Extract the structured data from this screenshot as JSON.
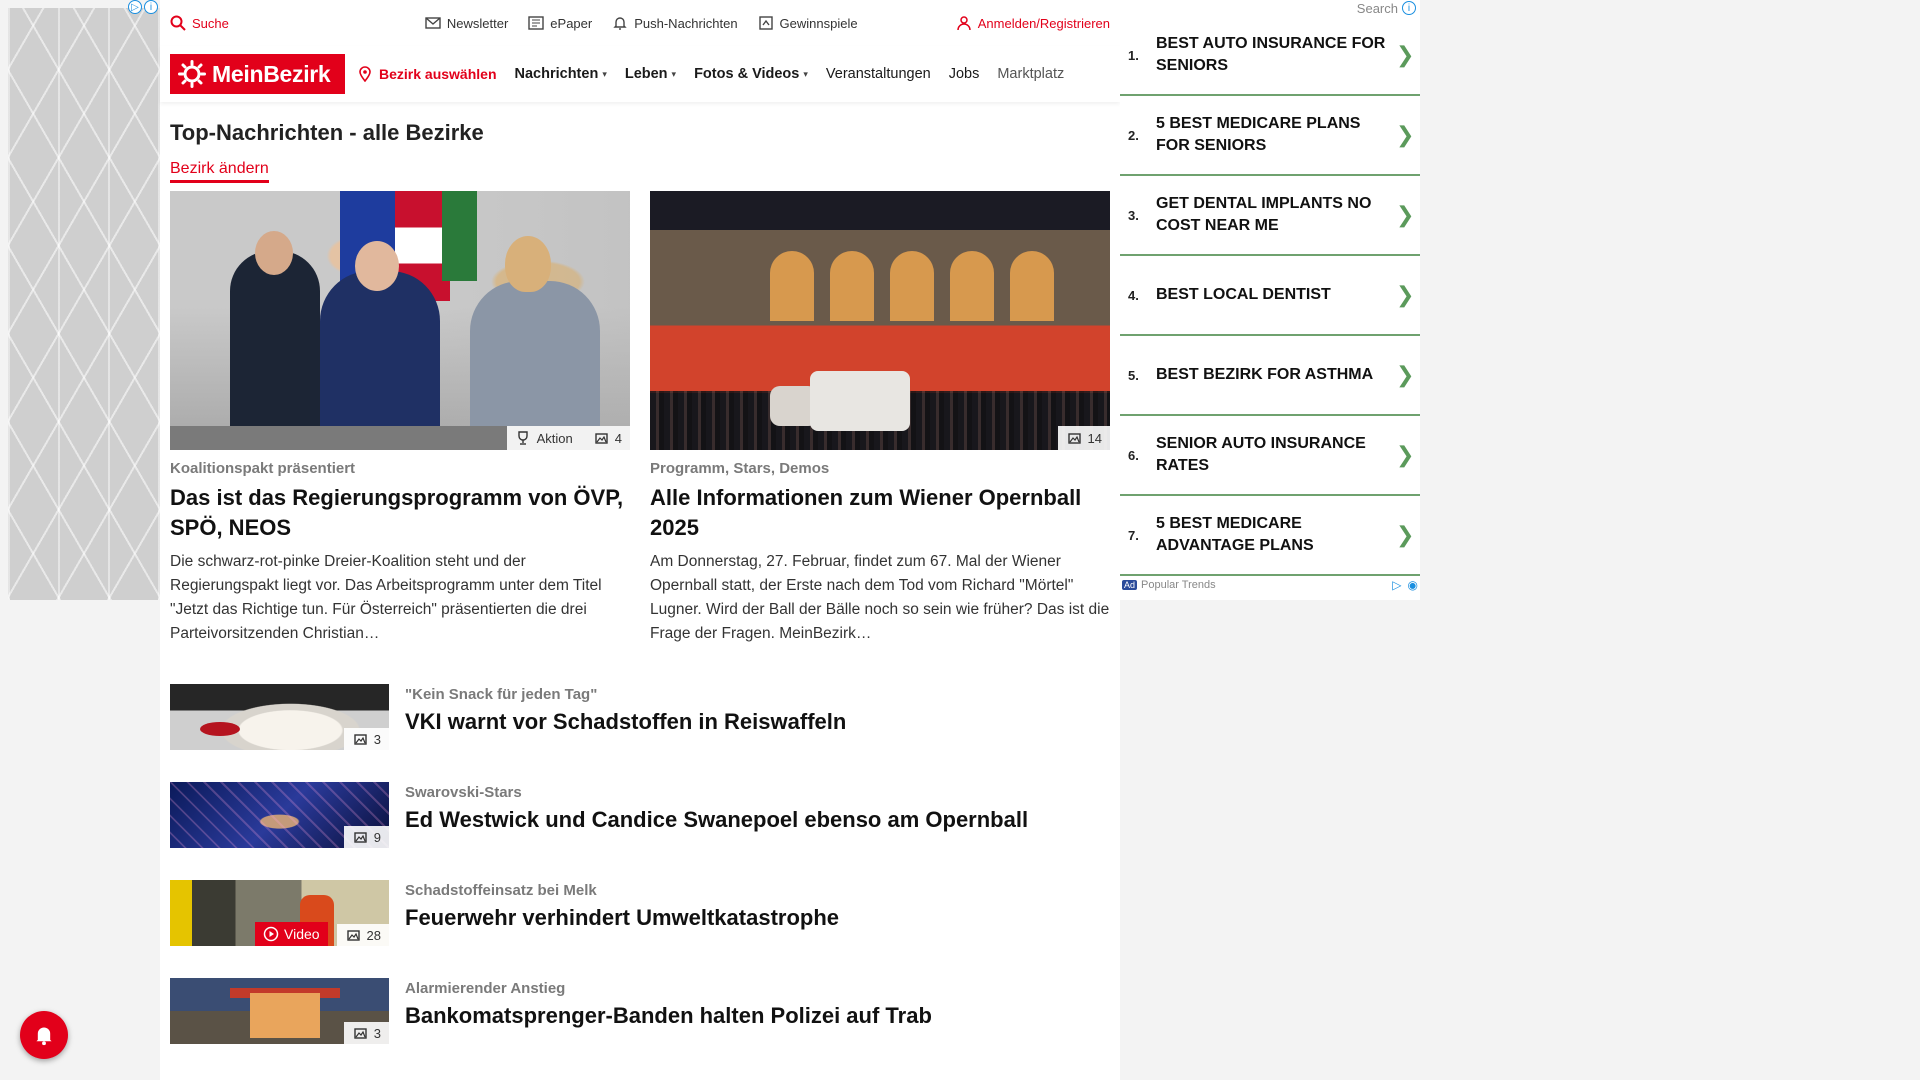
{
  "topbar": {
    "search": "Suche",
    "newsletter": "Newsletter",
    "epaper": "ePaper",
    "push": "Push-Nachrichten",
    "gewinnspiele": "Gewinnspiele",
    "login": "Anmelden/Registrieren"
  },
  "nav": {
    "logo": "MeinBezirk",
    "bezirk": "Bezirk auswählen",
    "items": [
      "Nachrichten",
      "Leben",
      "Fotos & Videos",
      "Veranstaltungen",
      "Jobs",
      "Marktplatz"
    ]
  },
  "section": {
    "title": "Top-Nachrichten - alle Bezirke",
    "change": "Bezirk ändern"
  },
  "top_articles": [
    {
      "kicker": "Koalitionspakt präsentiert",
      "headline": "Das ist das Regierungsprogramm von ÖVP, SPÖ, NEOS",
      "teaser": "Die schwarz-rot-pinke Dreier-Koalition steht und der Regierungspakt liegt vor. Das Arbeitsprogramm unter dem Titel \"Jetzt das Richtige tun. Für Österreich\" präsentierten die drei Parteivorsitzenden Christian…",
      "badge_label": "Aktion",
      "photo_count": "4"
    },
    {
      "kicker": "Programm, Stars, Demos",
      "headline": "Alle Informationen zum Wiener Opernball 2025",
      "teaser": "Am Donnerstag, 27. Februar, findet zum 67. Mal der Wiener Opernball statt, der Erste nach dem Tod vom Richard \"Mörtel\" Lugner. Wird der Ball der Bälle noch so sein wie früher? Das ist die Frage der Fragen. MeinBezirk…",
      "photo_count": "14"
    }
  ],
  "list": [
    {
      "kicker": "\"Kein Snack für jeden Tag\"",
      "headline": "VKI warnt vor Schadstoffen in Reiswaffeln",
      "photo_count": "3"
    },
    {
      "kicker": "Swarovski-Stars",
      "headline": "Ed Westwick und Candice Swanepoel ebenso am Opernball",
      "photo_count": "9"
    },
    {
      "kicker": "Schadstoffeinsatz bei Melk",
      "headline": "Feuerwehr verhindert Umweltkatastrophe",
      "photo_count": "28",
      "video_label": "Video"
    },
    {
      "kicker": "Alarmierender Anstieg",
      "headline": "Bankomatsprenger-Banden halten Polizei auf Trab",
      "photo_count": "3"
    }
  ],
  "ad": {
    "search_label": "Search",
    "items": [
      {
        "num": "1.",
        "text": "Best Auto Insurance For Seniors"
      },
      {
        "num": "2.",
        "text": "5 Best Medicare Plans For Seniors"
      },
      {
        "num": "3.",
        "text": "Get Dental Implants No Cost Near Me"
      },
      {
        "num": "4.",
        "text": "Best Local Dentist"
      },
      {
        "num": "5.",
        "text": "Best Bezirk For Asthma"
      },
      {
        "num": "6.",
        "text": "Senior Auto Insurance Rates"
      },
      {
        "num": "7.",
        "text": "5 Best Medicare Advantage Plans"
      }
    ],
    "ad_tag": "Ad",
    "footer": "Popular Trends"
  },
  "colors": {
    "brand": "#e2001a",
    "ad_accent": "#6fa26f"
  }
}
